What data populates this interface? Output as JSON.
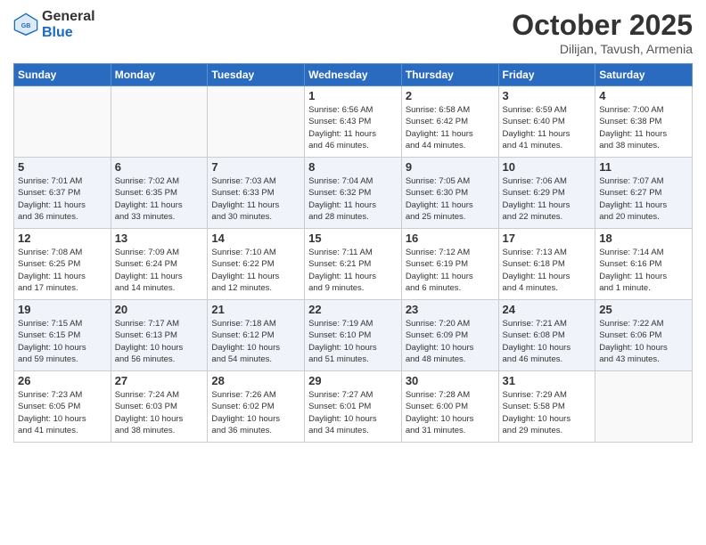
{
  "header": {
    "logo_general": "General",
    "logo_blue": "Blue",
    "month_title": "October 2025",
    "location": "Dilijan, Tavush, Armenia"
  },
  "weekdays": [
    "Sunday",
    "Monday",
    "Tuesday",
    "Wednesday",
    "Thursday",
    "Friday",
    "Saturday"
  ],
  "rows": [
    {
      "shaded": false,
      "cells": [
        {
          "day": "",
          "info": ""
        },
        {
          "day": "",
          "info": ""
        },
        {
          "day": "",
          "info": ""
        },
        {
          "day": "1",
          "info": "Sunrise: 6:56 AM\nSunset: 6:43 PM\nDaylight: 11 hours\nand 46 minutes."
        },
        {
          "day": "2",
          "info": "Sunrise: 6:58 AM\nSunset: 6:42 PM\nDaylight: 11 hours\nand 44 minutes."
        },
        {
          "day": "3",
          "info": "Sunrise: 6:59 AM\nSunset: 6:40 PM\nDaylight: 11 hours\nand 41 minutes."
        },
        {
          "day": "4",
          "info": "Sunrise: 7:00 AM\nSunset: 6:38 PM\nDaylight: 11 hours\nand 38 minutes."
        }
      ]
    },
    {
      "shaded": true,
      "cells": [
        {
          "day": "5",
          "info": "Sunrise: 7:01 AM\nSunset: 6:37 PM\nDaylight: 11 hours\nand 36 minutes."
        },
        {
          "day": "6",
          "info": "Sunrise: 7:02 AM\nSunset: 6:35 PM\nDaylight: 11 hours\nand 33 minutes."
        },
        {
          "day": "7",
          "info": "Sunrise: 7:03 AM\nSunset: 6:33 PM\nDaylight: 11 hours\nand 30 minutes."
        },
        {
          "day": "8",
          "info": "Sunrise: 7:04 AM\nSunset: 6:32 PM\nDaylight: 11 hours\nand 28 minutes."
        },
        {
          "day": "9",
          "info": "Sunrise: 7:05 AM\nSunset: 6:30 PM\nDaylight: 11 hours\nand 25 minutes."
        },
        {
          "day": "10",
          "info": "Sunrise: 7:06 AM\nSunset: 6:29 PM\nDaylight: 11 hours\nand 22 minutes."
        },
        {
          "day": "11",
          "info": "Sunrise: 7:07 AM\nSunset: 6:27 PM\nDaylight: 11 hours\nand 20 minutes."
        }
      ]
    },
    {
      "shaded": false,
      "cells": [
        {
          "day": "12",
          "info": "Sunrise: 7:08 AM\nSunset: 6:25 PM\nDaylight: 11 hours\nand 17 minutes."
        },
        {
          "day": "13",
          "info": "Sunrise: 7:09 AM\nSunset: 6:24 PM\nDaylight: 11 hours\nand 14 minutes."
        },
        {
          "day": "14",
          "info": "Sunrise: 7:10 AM\nSunset: 6:22 PM\nDaylight: 11 hours\nand 12 minutes."
        },
        {
          "day": "15",
          "info": "Sunrise: 7:11 AM\nSunset: 6:21 PM\nDaylight: 11 hours\nand 9 minutes."
        },
        {
          "day": "16",
          "info": "Sunrise: 7:12 AM\nSunset: 6:19 PM\nDaylight: 11 hours\nand 6 minutes."
        },
        {
          "day": "17",
          "info": "Sunrise: 7:13 AM\nSunset: 6:18 PM\nDaylight: 11 hours\nand 4 minutes."
        },
        {
          "day": "18",
          "info": "Sunrise: 7:14 AM\nSunset: 6:16 PM\nDaylight: 11 hours\nand 1 minute."
        }
      ]
    },
    {
      "shaded": true,
      "cells": [
        {
          "day": "19",
          "info": "Sunrise: 7:15 AM\nSunset: 6:15 PM\nDaylight: 10 hours\nand 59 minutes."
        },
        {
          "day": "20",
          "info": "Sunrise: 7:17 AM\nSunset: 6:13 PM\nDaylight: 10 hours\nand 56 minutes."
        },
        {
          "day": "21",
          "info": "Sunrise: 7:18 AM\nSunset: 6:12 PM\nDaylight: 10 hours\nand 54 minutes."
        },
        {
          "day": "22",
          "info": "Sunrise: 7:19 AM\nSunset: 6:10 PM\nDaylight: 10 hours\nand 51 minutes."
        },
        {
          "day": "23",
          "info": "Sunrise: 7:20 AM\nSunset: 6:09 PM\nDaylight: 10 hours\nand 48 minutes."
        },
        {
          "day": "24",
          "info": "Sunrise: 7:21 AM\nSunset: 6:08 PM\nDaylight: 10 hours\nand 46 minutes."
        },
        {
          "day": "25",
          "info": "Sunrise: 7:22 AM\nSunset: 6:06 PM\nDaylight: 10 hours\nand 43 minutes."
        }
      ]
    },
    {
      "shaded": false,
      "cells": [
        {
          "day": "26",
          "info": "Sunrise: 7:23 AM\nSunset: 6:05 PM\nDaylight: 10 hours\nand 41 minutes."
        },
        {
          "day": "27",
          "info": "Sunrise: 7:24 AM\nSunset: 6:03 PM\nDaylight: 10 hours\nand 38 minutes."
        },
        {
          "day": "28",
          "info": "Sunrise: 7:26 AM\nSunset: 6:02 PM\nDaylight: 10 hours\nand 36 minutes."
        },
        {
          "day": "29",
          "info": "Sunrise: 7:27 AM\nSunset: 6:01 PM\nDaylight: 10 hours\nand 34 minutes."
        },
        {
          "day": "30",
          "info": "Sunrise: 7:28 AM\nSunset: 6:00 PM\nDaylight: 10 hours\nand 31 minutes."
        },
        {
          "day": "31",
          "info": "Sunrise: 7:29 AM\nSunset: 5:58 PM\nDaylight: 10 hours\nand 29 minutes."
        },
        {
          "day": "",
          "info": ""
        }
      ]
    }
  ]
}
